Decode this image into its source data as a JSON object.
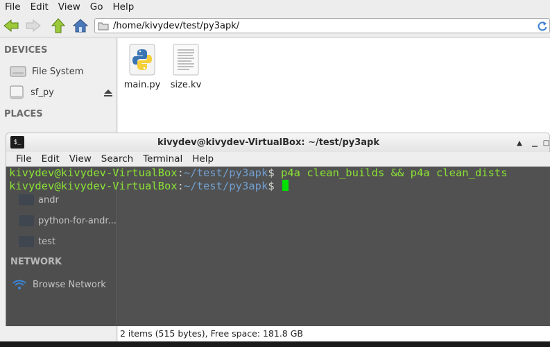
{
  "file_manager": {
    "menu": [
      "File",
      "Edit",
      "View",
      "Go",
      "Help"
    ],
    "address": "/home/kivydev/test/py3apk/",
    "sidebar": {
      "devices_heading": "DEVICES",
      "devices": [
        {
          "label": "File System",
          "icon": "harddisk-icon"
        },
        {
          "label": "sf_py",
          "icon": "drive-icon"
        }
      ],
      "places_heading": "PLACES",
      "places_visible": [
        "andr",
        "python-for-andr...",
        "test"
      ],
      "network_heading": "NETWORK",
      "network": [
        {
          "label": "Browse Network",
          "icon": "network-icon"
        }
      ]
    },
    "files": [
      {
        "name": "main.py",
        "icon": "python-file-icon"
      },
      {
        "name": "size.kv",
        "icon": "text-file-icon"
      }
    ],
    "status": "2 items (515 bytes), Free space: 181.8 GB"
  },
  "terminal": {
    "title": "kivydev@kivydev-VirtualBox: ~/test/py3apk",
    "menu": [
      "File",
      "Edit",
      "View",
      "Search",
      "Terminal",
      "Help"
    ],
    "lines": [
      {
        "user": "kivydev@kivydev-VirtualBox",
        "colon": ":",
        "path": "~/test/py3apk",
        "dollar": "$",
        "cmd": " p4a clean_builds && p4a clean_dists"
      },
      {
        "user": "kivydev@kivydev-VirtualBox",
        "colon": ":",
        "path": "~/test/py3apk",
        "dollar": "$",
        "cmd": " "
      }
    ],
    "colors": {
      "prompt_user": "#8ae234",
      "prompt_path": "#729fcf",
      "cursor": "#00e000"
    }
  }
}
